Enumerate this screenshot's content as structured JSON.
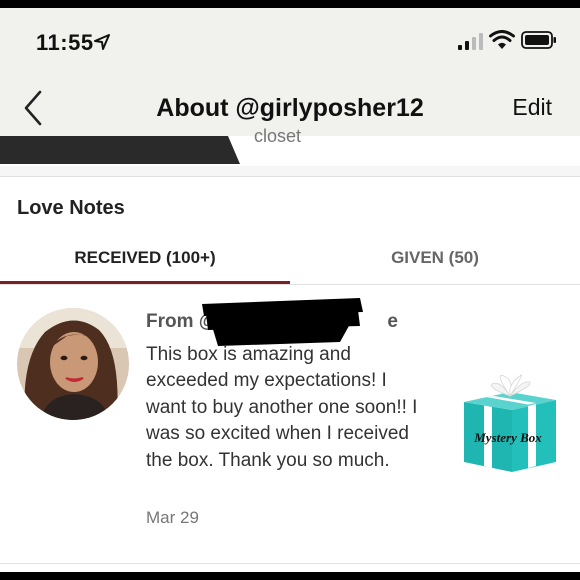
{
  "status_bar": {
    "time": "11:55",
    "icons": [
      "location-arrow-icon",
      "cellular-signal-icon",
      "wifi-icon",
      "battery-icon"
    ]
  },
  "nav": {
    "back_icon": "chevron-left-icon",
    "title": "About @girlyposher12",
    "edit_label": "Edit"
  },
  "closet_tab": {
    "label": "closet"
  },
  "section": {
    "title": "Love Notes"
  },
  "tabs": [
    {
      "label": "RECEIVED (100+)",
      "selected": true
    },
    {
      "label": "GIVEN (50)",
      "selected": false
    }
  ],
  "note": {
    "from_prefix": "From @",
    "from_suffix": "e",
    "text": "This box is amazing and exceeded my expectations! I want to buy another one soon!! I was so excited when I received the box. Thank you so much.",
    "date": "Mar 29",
    "gift_label": "Mystery Box"
  },
  "colors": {
    "accent": "#7a1f2b",
    "gift_box": "#1fb5b0",
    "header_bg": "#f1f1ee"
  }
}
